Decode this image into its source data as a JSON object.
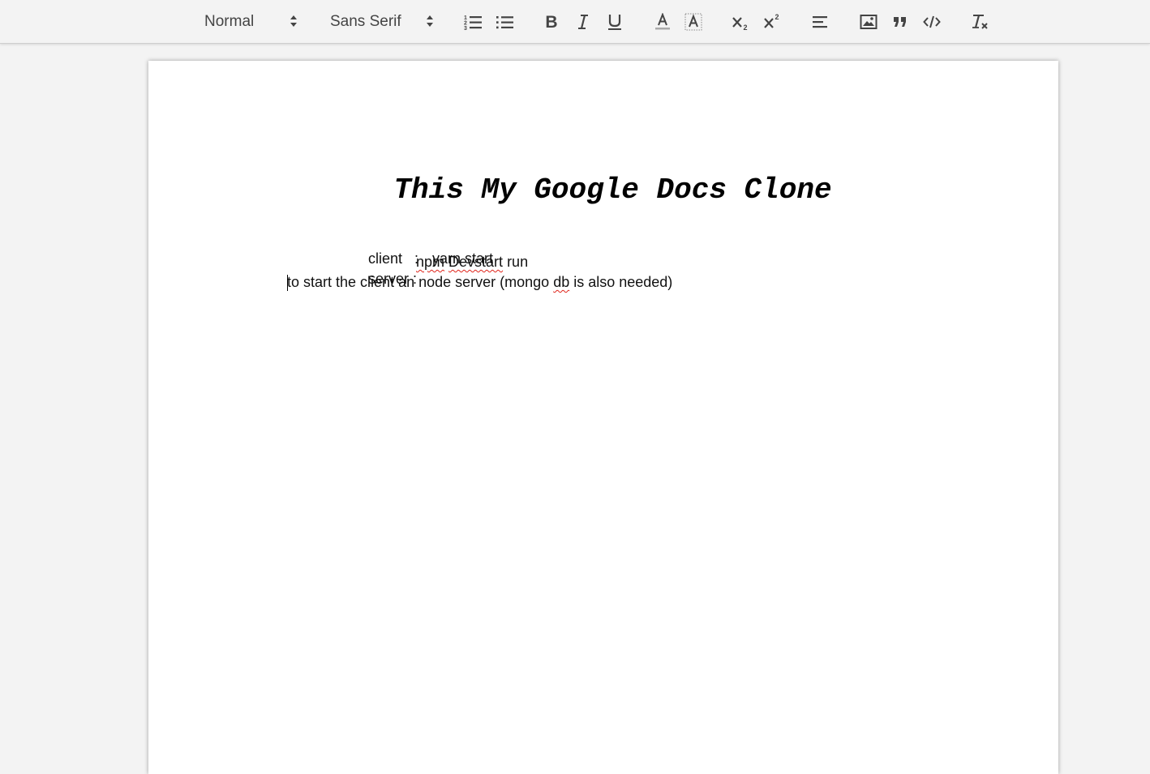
{
  "toolbar": {
    "heading_picker": "Normal",
    "font_picker": "Sans Serif",
    "ordered_list_icon": "ordered-list-icon",
    "bullet_list_icon": "bullet-list-icon",
    "bold_icon": "bold-icon",
    "italic_icon": "italic-icon",
    "underline_icon": "underline-icon",
    "text_color_icon": "text-color-icon",
    "highlight_icon": "highlight-color-icon",
    "subscript_icon": "subscript-icon",
    "superscript_icon": "superscript-icon",
    "align_icon": "align-left-icon",
    "image_icon": "image-icon",
    "blockquote_icon": "blockquote-icon",
    "code_icon": "code-block-icon",
    "clear_format_icon": "clear-formatting-icon"
  },
  "document": {
    "title": "This My Google Docs Clone",
    "lines": [
      {
        "label": "client   :",
        "command": [
          "",
          "",
          "yarn start"
        ]
      },
      {
        "label": "server :",
        "command": [
          "npm",
          "Devstart",
          " run"
        ]
      }
    ],
    "note_parts": [
      "to start the client an node server (mongo ",
      "db",
      " is also needed)"
    ]
  },
  "colors": {
    "toolbar_bg": "#f3f3f3",
    "page_bg": "#ffffff",
    "spellcheck": "#e0241a"
  }
}
